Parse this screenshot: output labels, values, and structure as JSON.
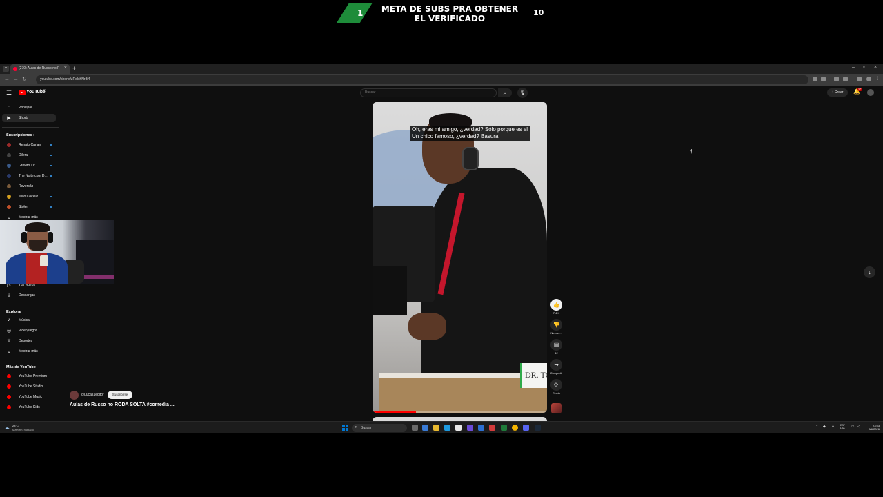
{
  "overlay": {
    "left_number": "1",
    "title": "META DE SUBS PRA OBTENER EL VERIFICADO",
    "right_number": "10"
  },
  "browser": {
    "tab_title": "(270) Aulas de Russo no R...",
    "url": "youtube.com/shorts/zRqlchNr3i4"
  },
  "youtube": {
    "logo_text": "YouTube",
    "logo_country": "BR",
    "search_placeholder": "Buscar",
    "create_label": "Crear",
    "notification_count": "9+",
    "sidebar": {
      "main": [
        {
          "label": "Principal",
          "icon": "home-icon"
        },
        {
          "label": "Shorts",
          "icon": "shorts-icon",
          "active": true
        }
      ],
      "subscriptions_heading": "Suscripciones",
      "subscriptions": [
        {
          "label": "Renato Cariani",
          "color": "#9c2a2a"
        },
        {
          "label": "Dilera",
          "color": "#444444"
        },
        {
          "label": "Growth TV",
          "color": "#3a5a8a"
        },
        {
          "label": "The Noite com D...",
          "color": "#2a3a6a"
        },
        {
          "label": "Reversão",
          "color": "#7a5a3a"
        },
        {
          "label": "Julio Cocielo",
          "color": "#d4a020"
        },
        {
          "label": "Stolen",
          "color": "#c0502a"
        }
      ],
      "show_more_subs": "Mostrar más",
      "you_items": [
        {
          "label": "Tus videos",
          "icon": "video-icon"
        },
        {
          "label": "Descargas",
          "icon": "download-icon"
        }
      ],
      "explore_heading": "Explorar",
      "explore": [
        {
          "label": "Música",
          "icon": "music-icon"
        },
        {
          "label": "Videojuegos",
          "icon": "gamepad-icon"
        },
        {
          "label": "Deportes",
          "icon": "trophy-icon"
        },
        {
          "label": "Mostrar más",
          "icon": "chevron-down-icon"
        }
      ],
      "more_heading": "Más de YouTube",
      "more": [
        {
          "label": "YouTube Premium"
        },
        {
          "label": "YouTube Studio"
        },
        {
          "label": "YouTube Music"
        },
        {
          "label": "YouTube Kids"
        }
      ]
    },
    "short": {
      "subtitle_line1": "Oh, eras mi amigo, ¿verdad? Sólo porque es el",
      "subtitle_line2": "Un chico famoso, ¿verdad? Basura.",
      "sign_text": "DR. TOM",
      "progress": 0.25,
      "channel": "@Lucas1editor",
      "subscribe_label": "Suscribirse",
      "title": "Aulas de Russo no RODA SOLTA #comedia ..."
    },
    "actions": {
      "like_count": "7.4 K",
      "dislike_label": "No me ...",
      "comments_count": "42",
      "share_label": "Compartir",
      "remix_label": "Remix"
    }
  },
  "taskbar": {
    "weather_temp": "28°C",
    "weather_desc": "Mayorm. nublado",
    "search_label": "Buscar",
    "lang_line1": "ESP",
    "lang_line2": "LAA",
    "time": "23:53",
    "date": "5/6/2026"
  },
  "colors": {
    "yt_red": "#ff0000",
    "overlay_green": "#1e8c3a",
    "page_bg": "#0f0f0f"
  }
}
